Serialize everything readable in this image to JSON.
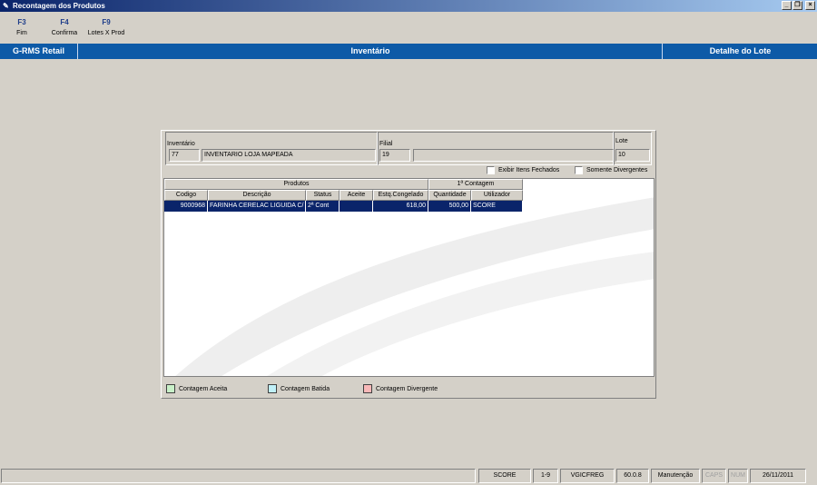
{
  "window": {
    "title": "Recontagem dos Produtos"
  },
  "toolbar": [
    {
      "key": "F3",
      "label": "Fim"
    },
    {
      "key": "F4",
      "label": "Confirma"
    },
    {
      "key": "F9",
      "label": "Lotes X Prod"
    }
  ],
  "header": {
    "brand": "G-RMS Retail",
    "center": "Inventário",
    "right": "Detalhe do Lote"
  },
  "form": {
    "inventario_label": "Inventário",
    "inventario_code": "77",
    "inventario_desc": "INVENTARIO LOJA MAPEADA",
    "filial_label": "Filial",
    "filial_code": "19",
    "filial_desc": "",
    "lote_label": "Lote",
    "lote_value": "10"
  },
  "options": {
    "exibir_itens_fechados": "Exibir Itens Fechados",
    "somente_divergentes": "Somente Divergentes"
  },
  "grid": {
    "group_produtos": "Produtos",
    "group_contagem": "1ª Contagem",
    "columns": [
      "Codigo",
      "Descrição",
      "Status",
      "Aceite",
      "Estq.Congelado",
      "Quantidade",
      "Utilizador"
    ],
    "rows": [
      {
        "codigo": "9000968",
        "descricao": "FARINHA CERELAC LIGUIDA C/",
        "status": "2ª Cont",
        "aceite": "",
        "estq": "618,00",
        "quantidade": "500,00",
        "utilizador": "SCORE"
      }
    ]
  },
  "legend": [
    {
      "label": "Contagem Aceita",
      "color": "#c8f0c8"
    },
    {
      "label": "Contagem Batida",
      "color": "#c0f0f8"
    },
    {
      "label": "Contagem Divergente",
      "color": "#f8b8b8"
    }
  ],
  "statusbar": {
    "user": "SCORE",
    "range": "1-9",
    "module": "VGICFREG",
    "version": "60.0.8",
    "mode": "Manutenção",
    "caps": "CAPS",
    "num": "NUM",
    "date": "26/11/2011"
  },
  "colors": {
    "accent": "#0d5aa7",
    "selection": "#0a246a",
    "face": "#d4d0c8"
  }
}
